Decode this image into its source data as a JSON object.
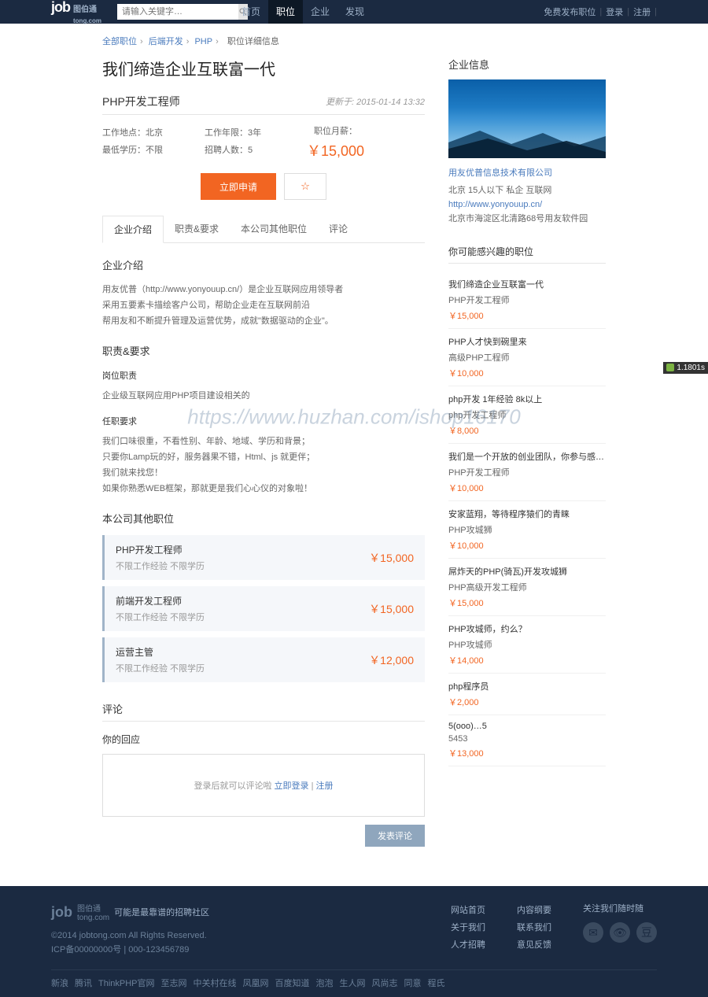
{
  "header": {
    "logo_main": "job",
    "logo_sub": "图伯通",
    "logo_domain": "tong.com",
    "search_placeholder": "请输入关键字…",
    "nav": [
      "首页",
      "职位",
      "企业",
      "发现"
    ],
    "right": {
      "post": "免费发布职位",
      "login": "登录",
      "register": "注册"
    }
  },
  "breadcrumb": {
    "a": "全部职位",
    "b": "后端开发",
    "c": "PHP",
    "d": "职位详细信息"
  },
  "page": {
    "title": "我们缔造企业互联富一代",
    "job_title": "PHP开发工程师",
    "update": "更新于: 2015-01-14 13:32",
    "info": {
      "location_label": "工作地点：",
      "location": "北京",
      "exp_label": "工作年限：",
      "exp": "3年",
      "edu_label": "最低学历：",
      "edu": "不限",
      "count_label": "招聘人数：",
      "count": "5",
      "salary_label": "职位月薪：",
      "salary": "￥15,000"
    },
    "apply": "立即申请",
    "tabs": [
      "企业介绍",
      "职责&要求",
      "本公司其他职位",
      "评论"
    ],
    "intro": {
      "title": "企业介绍",
      "p1": "用友优普（http://www.yonyouup.cn/）是企业互联网应用领导者",
      "p2": "采用五要素卡描绘客户公司，帮助企业走在互联网前沿",
      "p3": "帮用友和不断提升管理及运营优势，成就\"数据驱动的企业\"。"
    },
    "req": {
      "title": "职责&要求",
      "sub1": "岗位职责",
      "p1": "企业级互联网应用PHP项目建设相关的",
      "sub2": "任职要求",
      "p2": "我们口味很重，不看性别、年龄、地域、学历和背景；",
      "p3": "只要你Lamp玩的好，服务器果不错，Html、js 就更伴；",
      "p4": "我们就来找您！",
      "p5": "如果你熟悉WEB框架，那就更是我们心心仪的对象啦！"
    },
    "others": {
      "title": "本公司其他职位",
      "items": [
        {
          "name": "PHP开发工程师",
          "meta": "不限工作经验 不限学历",
          "salary": "￥15,000"
        },
        {
          "name": "前端开发工程师",
          "meta": "不限工作经验 不限学历",
          "salary": "￥15,000"
        },
        {
          "name": "运营主管",
          "meta": "不限工作经验 不限学历",
          "salary": "￥12,000"
        }
      ]
    },
    "comments": {
      "title": "评论",
      "label": "你的回应",
      "hint_pre": "登录后就可以评论啦 ",
      "login": "立即登录",
      "sep": " | ",
      "register": "注册",
      "submit": "发表评论"
    }
  },
  "company": {
    "title": "企业信息",
    "name": "用友优普信息技术有限公司",
    "meta": "北京   15人以下   私企   互联网",
    "url": "http://www.yonyouup.cn/",
    "address": "北京市海淀区北清路68号用友软件园"
  },
  "recommend": {
    "title": "你可能感兴趣的职位",
    "items": [
      {
        "t1": "我们缔造企业互联富一代",
        "t2": "PHP开发工程师",
        "p": "￥15,000"
      },
      {
        "t1": "PHP人才快到碗里来",
        "t2": "高级PHP工程师",
        "p": "￥10,000"
      },
      {
        "t1": "php开发 1年经验 8k以上",
        "t2": "php开发工程师",
        "p": "￥8,000"
      },
      {
        "t1": "我们是一个开放的创业团队，你参与感，都任性，…",
        "t2": "PHP开发工程师",
        "p": "￥10,000"
      },
      {
        "t1": "安家蓝翔，等待程序猿们的青睐",
        "t2": "PHP攻城狮",
        "p": "￥10,000"
      },
      {
        "t1": "屌炸天的PHP(骑瓦)开发攻城狮",
        "t2": "PHP高级开发工程师",
        "p": "￥15,000"
      },
      {
        "t1": "PHP攻城师，约么？",
        "t2": "PHP攻城师",
        "p": "￥14,000"
      },
      {
        "t1": "php程序员",
        "t2": "",
        "p": "￥2,000"
      },
      {
        "t1": "5(ооо)…5",
        "t2": "5453",
        "p": "￥13,000"
      }
    ]
  },
  "footer": {
    "slogan": "可能是最靠谱的招聘社区",
    "copyright": "©2014 jobtong.com All Rights Reserved.",
    "icp": "ICP备00000000号 | 000-123456789",
    "col1": [
      "网站首页",
      "关于我们",
      "人才招聘"
    ],
    "col2": [
      "内容纲要",
      "联系我们",
      "意见反馈"
    ],
    "social_title": "关注我们随时随",
    "bottom_links": [
      "新浪",
      "腾讯",
      "ThinkPHP官网",
      "至志网",
      "中关村在线",
      "凤凰网",
      "百度知道",
      "泡泡",
      "生人网",
      "风尚志",
      "同意",
      "程氏"
    ]
  },
  "watermark": "https://www.huzhan.com/ishop16170",
  "badge": "1.1801s"
}
